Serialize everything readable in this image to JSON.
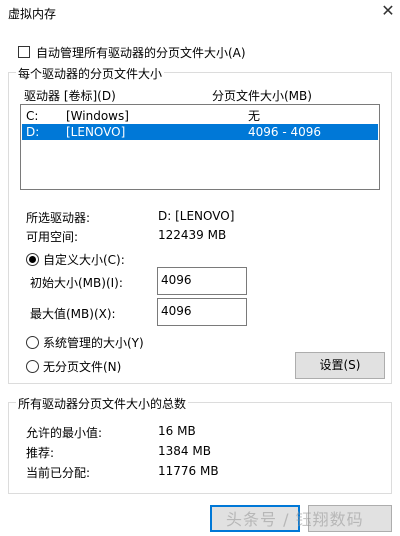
{
  "window": {
    "title": "虚拟内存"
  },
  "auto_manage": {
    "label": "自动管理所有驱动器的分页文件大小(A)",
    "checked": false
  },
  "drives_group": {
    "title": "每个驱动器的分页文件大小",
    "col_drive": "驱动器 [卷标](D)",
    "col_size": "分页文件大小(MB)",
    "rows": [
      {
        "letter": "C:",
        "label": "[Windows]",
        "size": "无",
        "selected": false
      },
      {
        "letter": "D:",
        "label": "[LENOVO]",
        "size": "4096 - 4096",
        "selected": true
      }
    ]
  },
  "selected_info": {
    "drive_label": "所选驱动器:",
    "drive_value": "D:  [LENOVO]",
    "space_label": "可用空间:",
    "space_value": "122439 MB"
  },
  "custom_size": {
    "label": "自定义大小(C):",
    "selected": true,
    "initial_label": "初始大小(MB)(I):",
    "initial_value": "4096",
    "max_label": "最大值(MB)(X):",
    "max_value": "4096"
  },
  "system_managed": {
    "label": "系统管理的大小(Y)",
    "selected": false
  },
  "no_paging": {
    "label": "无分页文件(N)",
    "selected": false
  },
  "set_button": {
    "label": "设置(S)"
  },
  "totals_group": {
    "title": "所有驱动器分页文件大小的总数",
    "min_label": "允许的最小值:",
    "min_value": "16 MB",
    "rec_label": "推荐:",
    "rec_value": "1384 MB",
    "cur_label": "当前已分配:",
    "cur_value": "11776 MB"
  },
  "watermark": {
    "text": "头条号 / 钰翔数码"
  },
  "colors": {
    "selection": "#0078d7",
    "button_face": "#e1e1e1",
    "focus_border": "#0078d7"
  }
}
